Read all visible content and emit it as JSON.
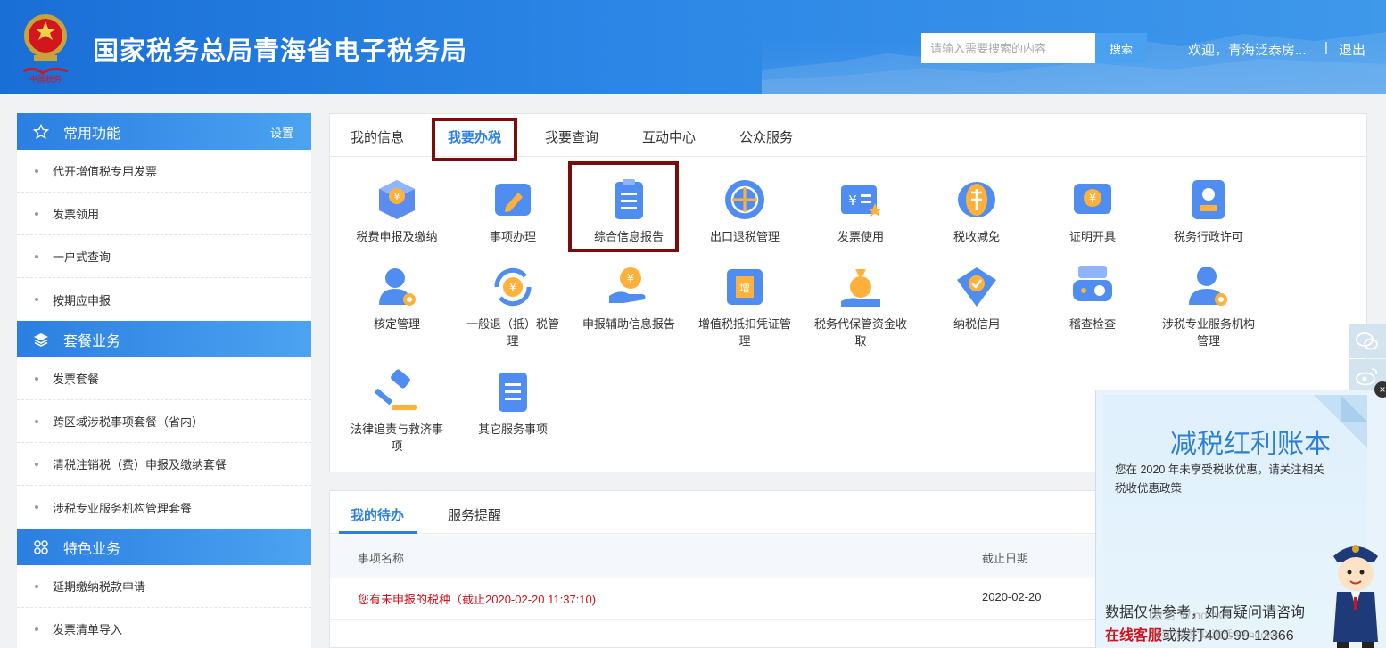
{
  "header": {
    "site_title": "国家税务总局青海省电子税务局",
    "search_placeholder": "请输入需要搜索的内容",
    "search_button": "搜索",
    "welcome": "欢迎，青海泛泰房...",
    "separator": "|",
    "logout": "退出"
  },
  "sidebar": {
    "sections": [
      {
        "title": "常用功能",
        "icon": "star-icon",
        "action": "设置",
        "items": [
          "代开增值税专用发票",
          "发票领用",
          "一户式查询",
          "按期应申报"
        ]
      },
      {
        "title": "套餐业务",
        "icon": "layers-icon",
        "items": [
          "发票套餐",
          "跨区域涉税事项套餐（省内）",
          "清税注销税（费）申报及缴纳套餐",
          "涉税专业服务机构管理套餐"
        ]
      },
      {
        "title": "特色业务",
        "icon": "grid-icon",
        "items": [
          "延期缴纳税款申请",
          "发票清单导入"
        ]
      }
    ]
  },
  "main_tabs": [
    "我的信息",
    "我要办税",
    "我要查询",
    "互动中心",
    "公众服务"
  ],
  "active_tab": "我要办税",
  "services": [
    {
      "label": "税费申报及缴纳",
      "icon": "tax-declare-icon"
    },
    {
      "label": "事项办理",
      "icon": "edit-icon"
    },
    {
      "label": "综合信息报告",
      "icon": "clipboard-icon"
    },
    {
      "label": "出口退税管理",
      "icon": "globe-icon"
    },
    {
      "label": "发票使用",
      "icon": "invoice-icon"
    },
    {
      "label": "税收减免",
      "icon": "tax-relief-icon"
    },
    {
      "label": "证明开具",
      "icon": "certificate-icon"
    },
    {
      "label": "税务行政许可",
      "icon": "permit-icon"
    },
    {
      "label": "核定管理",
      "icon": "user-gear-icon"
    },
    {
      "label": "一般退（抵）税管理",
      "icon": "refund-icon"
    },
    {
      "label": "申报辅助信息报告",
      "icon": "hand-coin-icon"
    },
    {
      "label": "增值税抵扣凭证管理",
      "icon": "vat-ticket-icon"
    },
    {
      "label": "税务代保管资金收取",
      "icon": "money-bag-icon"
    },
    {
      "label": "纳税信用",
      "icon": "credit-icon"
    },
    {
      "label": "稽查检查",
      "icon": "inspect-icon"
    },
    {
      "label": "涉税专业服务机构管理",
      "icon": "agency-icon"
    },
    {
      "label": "法律追责与救济事项",
      "icon": "gavel-icon"
    },
    {
      "label": "其它服务事项",
      "icon": "list-icon"
    }
  ],
  "todo": {
    "tabs": [
      "我的待办",
      "服务提醒"
    ],
    "columns": [
      "事项名称",
      "截止日期"
    ],
    "rows": [
      {
        "name": "您有未申报的税种（截止2020-02-20 11:37:10)",
        "deadline": "2020-02-20"
      }
    ]
  },
  "banner": {
    "title": "减税红利账本",
    "text": "您在 2020 年未享受税收优惠，请关注相关税收优惠政策",
    "footer_line1": "数据仅供参考，如有疑问请咨询",
    "footer_red": "在线客服",
    "footer_rest": "或拨打400-99-12366"
  },
  "watermark": [
    "激活 Windows",
    "转到\"设置\"以激活 Windows。"
  ],
  "colors": {
    "primary": "#2b7fe0",
    "header": "#1a6fd6",
    "highlight": "#7a0c0c",
    "red": "#d0101a"
  }
}
